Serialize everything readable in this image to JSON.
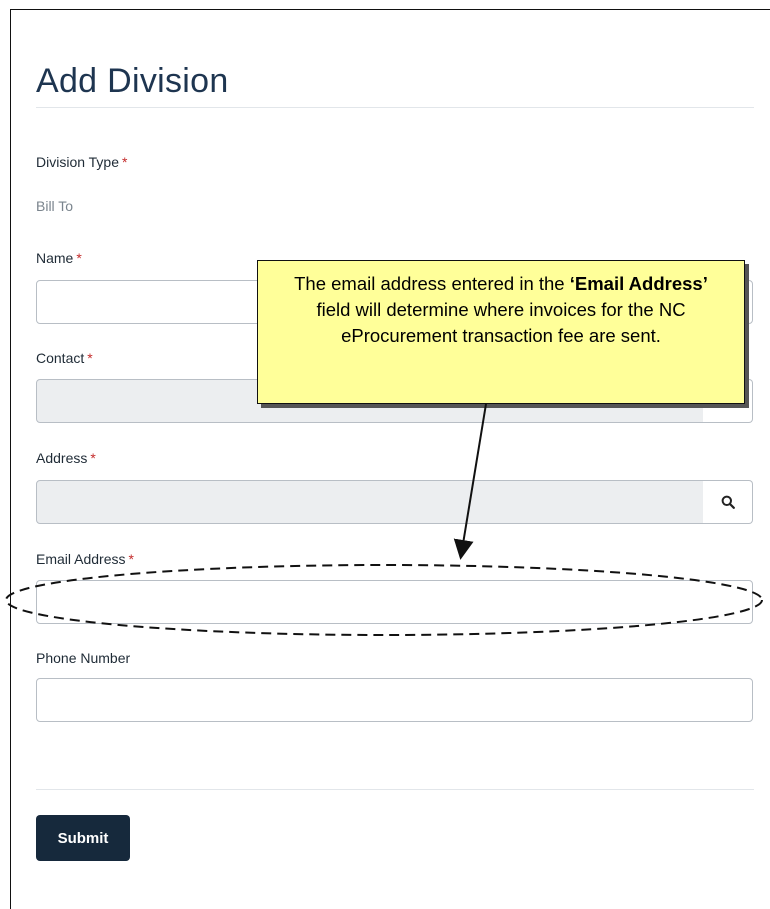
{
  "form": {
    "title": "Add Division",
    "division_type_label": "Division Type",
    "division_type_value": "Bill To",
    "name_label": "Name",
    "contact_label": "Contact",
    "address_label": "Address",
    "email_label": "Email Address",
    "phone_label": "Phone Number",
    "required_marker": "*",
    "submit_label": "Submit"
  },
  "callout": {
    "text_before": "The email address entered in the ",
    "text_bold": "‘Email Address’",
    "text_after": " field will determine where invoices for the NC eProcurement transaction fee are sent."
  },
  "icons": {
    "lookup": "search-icon"
  },
  "colors": {
    "title": "#1e3550",
    "required": "#c42b2b",
    "submit_bg": "#16293c",
    "readonly_bg": "#eceef0",
    "callout_bg": "#ffff99"
  }
}
